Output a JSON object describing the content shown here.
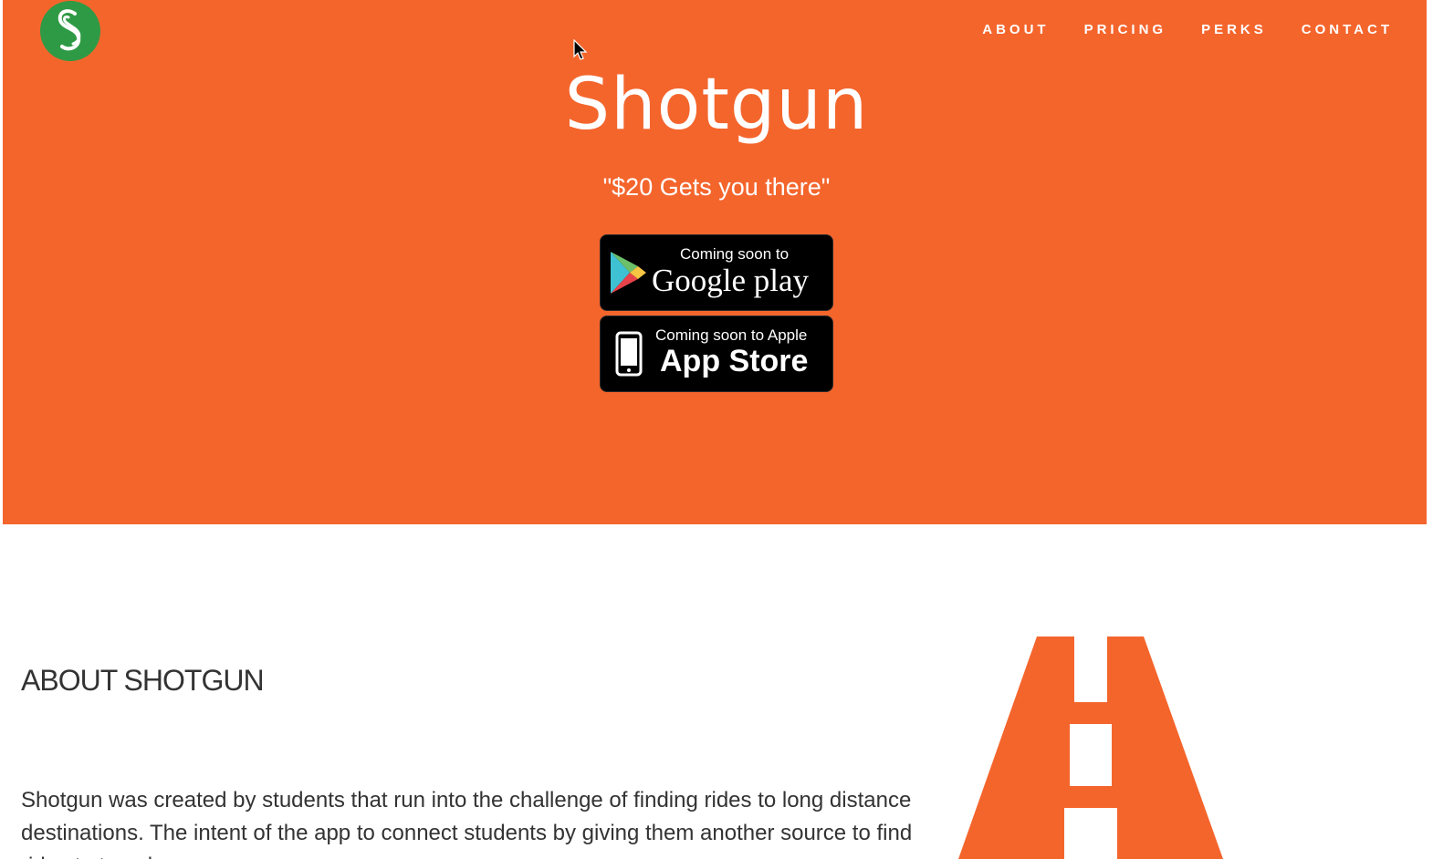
{
  "header": {
    "logo_icon": "shotgun-s-logo",
    "nav": [
      "ABOUT",
      "PRICING",
      "PERKS",
      "CONTACT"
    ]
  },
  "hero": {
    "title": "Shotgun",
    "tagline": "\"$20 Gets you there\"",
    "background_color": "#f4652c",
    "google_play": {
      "small_text": "Coming soon to",
      "big_text": "Google play",
      "icon": "google-play-icon"
    },
    "app_store": {
      "small_text": "Coming soon to Apple",
      "big_text": "App Store",
      "icon": "phone-icon"
    }
  },
  "about": {
    "heading": "ABOUT SHOTGUN",
    "text": "Shotgun was created by students that run into the challenge of finding rides to long distance destinations. The intent of the app to connect students by giving them another source to find rides to travel.",
    "illustration": "road-icon"
  },
  "colors": {
    "accent": "#f4652c",
    "logo_green": "#2f9a45"
  }
}
